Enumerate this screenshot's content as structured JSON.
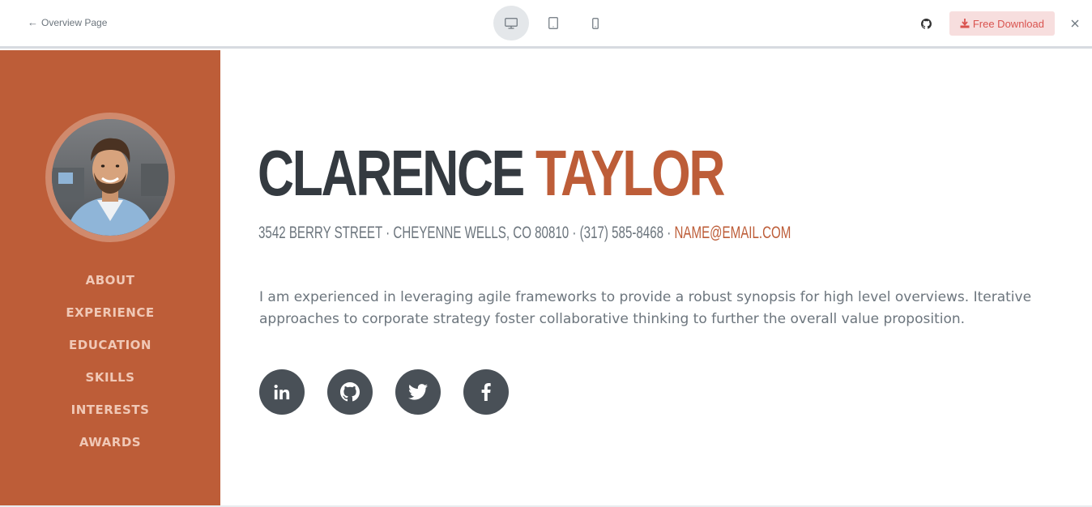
{
  "topbar": {
    "back_label": "Overview Page",
    "download_label": "Free Download",
    "devices": [
      "desktop-icon",
      "tablet-icon",
      "mobile-icon"
    ],
    "active_device": "desktop"
  },
  "sidebar": {
    "nav": [
      {
        "label": "ABOUT"
      },
      {
        "label": "EXPERIENCE"
      },
      {
        "label": "EDUCATION"
      },
      {
        "label": "SKILLS"
      },
      {
        "label": "INTERESTS"
      },
      {
        "label": "AWARDS"
      }
    ]
  },
  "about": {
    "first_name": "CLARENCE",
    "last_name": "TAYLOR",
    "address": "3542 BERRY STREET · CHEYENNE WELLS, CO 80810 · (317) 585-8468 ·",
    "email": "NAME@EMAIL.COM",
    "lead": "I am experienced in leveraging agile frameworks to provide a robust synopsis for high level overviews. Iterative approaches to corporate strategy foster collaborative thinking to further the overall value proposition.",
    "social": [
      "linkedin-icon",
      "github-icon",
      "twitter-icon",
      "facebook-icon"
    ]
  },
  "colors": {
    "primary": "#bd5d38",
    "dark": "#343a40",
    "muted": "#6c757d",
    "social_bg": "#495057"
  }
}
